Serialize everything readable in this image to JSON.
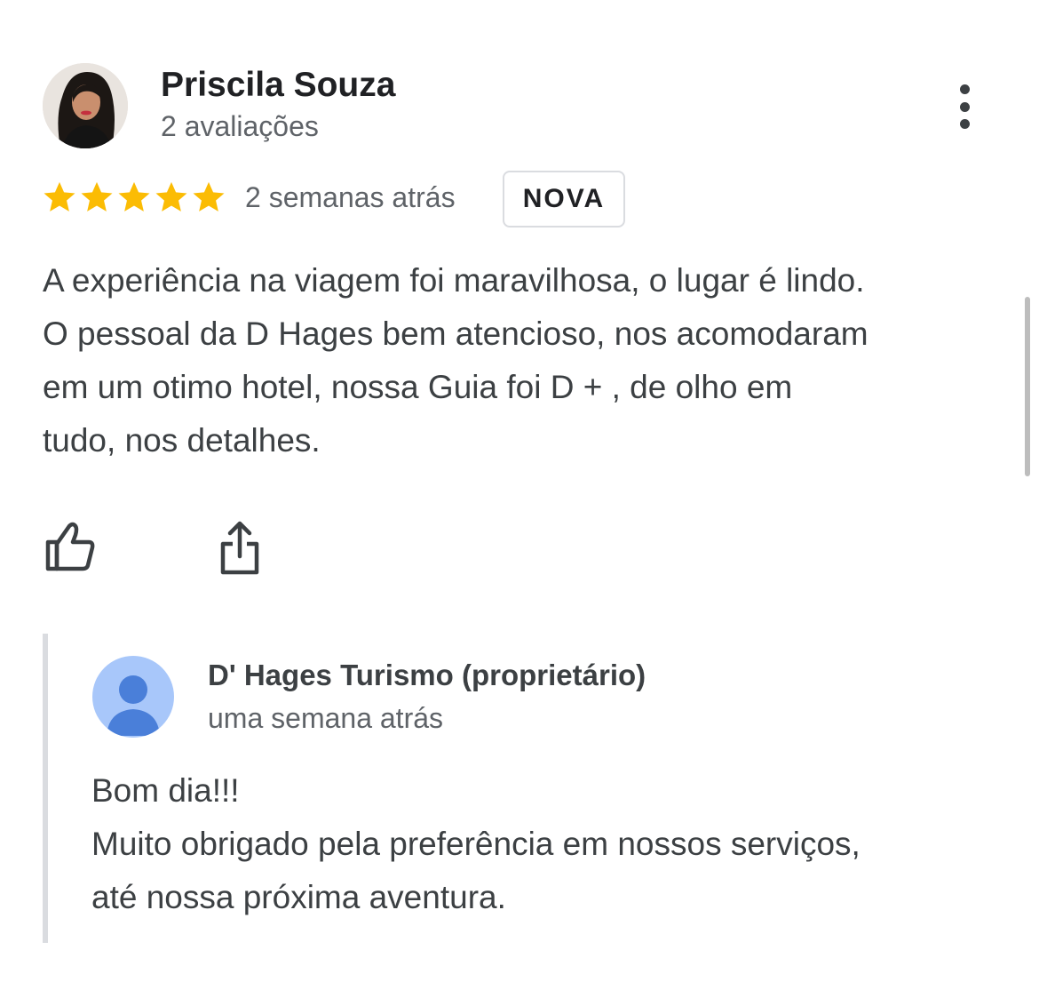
{
  "review": {
    "author_name": "Priscila Souza",
    "author_meta": "2 avaliações",
    "rating": 5,
    "rating_max": 5,
    "date": "2 semanas atrás",
    "badge": "NOVA",
    "text_lines": [
      "A experiência na viagem foi maravilhosa, o lugar é lindo.",
      "O pessoal da D Hages bem atencioso, nos acomodaram",
      "em um otimo hotel, nossa Guia foi D + , de olho em",
      "tudo, nos detalhes."
    ]
  },
  "owner_reply": {
    "name": "D' Hages Turismo (proprietário)",
    "date": "uma semana atrás",
    "text_lines": [
      "Bom dia!!!",
      "Muito obrigado pela preferência em nossos serviços,",
      "até nossa próxima aventura."
    ]
  },
  "icons": {
    "more": "more-vert-icon",
    "like": "thumbs-up-icon",
    "share": "share-icon",
    "star": "star-icon"
  },
  "colors": {
    "star": "#fbbc04",
    "text_primary": "#202124",
    "text_secondary": "#5f6368",
    "owner_avatar_bg": "#a8c7fa",
    "owner_avatar_fg": "#4a7fd9",
    "reply_bar": "#dadce0"
  }
}
